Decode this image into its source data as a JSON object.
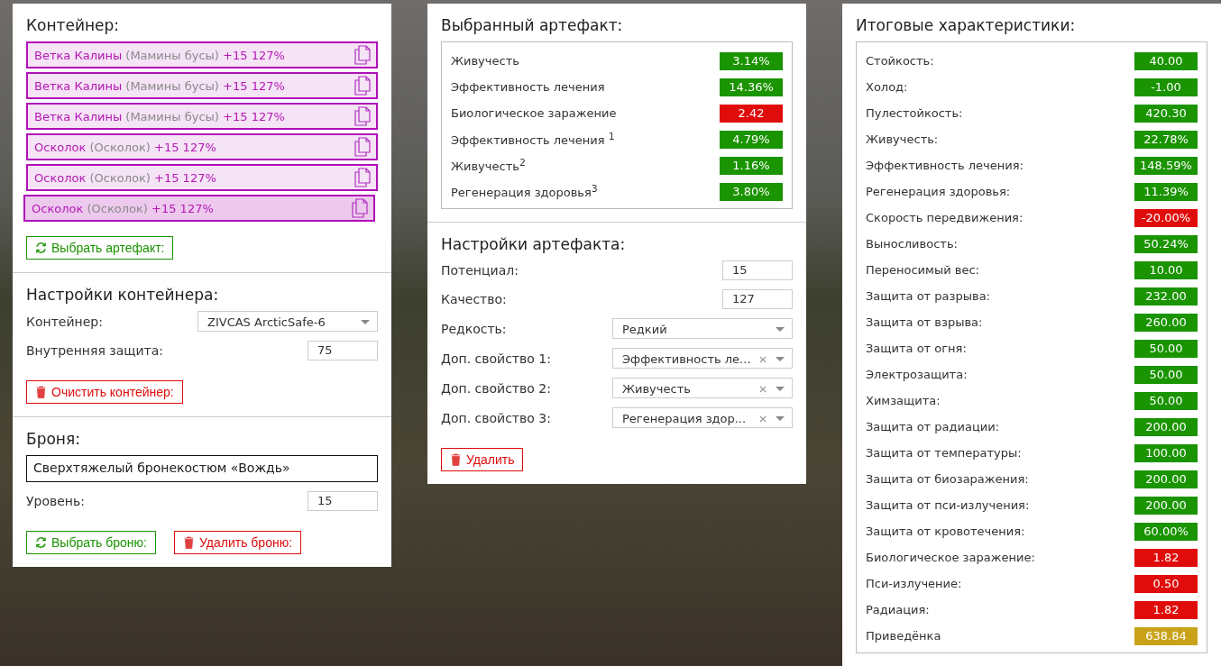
{
  "container_panel": {
    "title": "Контейнер:",
    "slots": [
      {
        "name": "Ветка Калины",
        "original": "(Мамины бусы)",
        "bonus": "+15 127%",
        "selected": false
      },
      {
        "name": "Ветка Калины",
        "original": "(Мамины бусы)",
        "bonus": "+15 127%",
        "selected": false
      },
      {
        "name": "Ветка Калины",
        "original": "(Мамины бусы)",
        "bonus": "+15 127%",
        "selected": false
      },
      {
        "name": "Осколок",
        "original": "(Осколок)",
        "bonus": "+15 127%",
        "selected": false
      },
      {
        "name": "Осколок",
        "original": "(Осколок)",
        "bonus": "+15 127%",
        "selected": false
      },
      {
        "name": "Осколок",
        "original": "(Осколок)",
        "bonus": "+15 127%",
        "selected": true
      }
    ],
    "choose_button": "Выбрать артефакт:"
  },
  "container_settings": {
    "title": "Настройки контейнера:",
    "fields": [
      {
        "kind": "select",
        "label": "Контейнер:",
        "value": "ZIVCAS ArcticSafe-6"
      },
      {
        "kind": "input",
        "label": "Внутренняя защита:",
        "value": "75"
      }
    ],
    "clear_button": "Очистить контейнер:"
  },
  "armor": {
    "title": "Броня:",
    "name": "Сверхтяжелый бронекостюм «Вождь»",
    "level_label": "Уровень:",
    "level_value": "15",
    "choose_button": "Выбрать броню:",
    "delete_button": "Удалить броню:"
  },
  "selected_artifact": {
    "title": "Выбранный артефакт:",
    "stats": [
      {
        "label": "Живучесть",
        "value": "3.14%",
        "color": "#1a9400"
      },
      {
        "label": "Эффективность лечения",
        "value": "14.36%",
        "color": "#1a9400"
      },
      {
        "label": "Биологическое заражение",
        "value": "2.42",
        "color": "#e00b0b"
      },
      {
        "label": "Эффективность лечения $^{1}$",
        "value": "4.79%",
        "color": "#1a9400"
      },
      {
        "label": "Живучесть$^{2}$",
        "value": "1.16%",
        "color": "#1a9400"
      },
      {
        "label": "Регенерация здоровья$^{3}$",
        "value": "3.80%",
        "color": "#1a9400"
      }
    ]
  },
  "artifact_settings": {
    "title": "Настройки артефакта:",
    "fields": [
      {
        "kind": "input",
        "label": "Потенциал:",
        "value": "15"
      },
      {
        "kind": "input",
        "label": "Качество:",
        "value": "127"
      },
      {
        "kind": "select",
        "label": "Редкость:",
        "value": "Редкий"
      },
      {
        "kind": "select_clear",
        "label": "Доп. свойство 1:",
        "value": "Эффективность ле..."
      },
      {
        "kind": "select_clear",
        "label": "Доп. свойство 2:",
        "value": "Живучесть"
      },
      {
        "kind": "select_clear",
        "label": "Доп. свойство 3:",
        "value": "Регенерация здор..."
      }
    ],
    "delete_button": "Удалить"
  },
  "totals": {
    "title": "Итоговые характеристики:",
    "stats": [
      {
        "label": "Стойкость:",
        "value": "40.00",
        "color": "#1a9400"
      },
      {
        "label": "Холод:",
        "value": "-1.00",
        "color": "#1a9400"
      },
      {
        "label": "Пулестойкость:",
        "value": "420.30",
        "color": "#1a9400"
      },
      {
        "label": "Живучесть:",
        "value": "22.78%",
        "color": "#1a9400"
      },
      {
        "label": "Эффективность лечения:",
        "value": "148.59%",
        "color": "#1a9400"
      },
      {
        "label": "Регенерация здоровья:",
        "value": "11.39%",
        "color": "#1a9400"
      },
      {
        "label": "Скорость передвижения:",
        "value": "-20.00%",
        "color": "#e00b0b"
      },
      {
        "label": "Выносливость:",
        "value": "50.24%",
        "color": "#1a9400"
      },
      {
        "label": "Переносимый вес:",
        "value": "10.00",
        "color": "#1a9400"
      },
      {
        "label": "Защита от разрыва:",
        "value": "232.00",
        "color": "#1a9400"
      },
      {
        "label": "Защита от взрыва:",
        "value": "260.00",
        "color": "#1a9400"
      },
      {
        "label": "Защита от огня:",
        "value": "50.00",
        "color": "#1a9400"
      },
      {
        "label": "Электрозащита:",
        "value": "50.00",
        "color": "#1a9400"
      },
      {
        "label": "Химзащита:",
        "value": "50.00",
        "color": "#1a9400"
      },
      {
        "label": "Защита от радиации:",
        "value": "200.00",
        "color": "#1a9400"
      },
      {
        "label": "Защита от температуры:",
        "value": "100.00",
        "color": "#1a9400"
      },
      {
        "label": "Защита от биозаражения:",
        "value": "200.00",
        "color": "#1a9400"
      },
      {
        "label": "Защита от пси-излучения:",
        "value": "200.00",
        "color": "#1a9400"
      },
      {
        "label": "Защита от кровотечения:",
        "value": "60.00%",
        "color": "#1a9400"
      },
      {
        "label": "Биологическое заражение:",
        "value": "1.82",
        "color": "#e00b0b"
      },
      {
        "label": "Пси-излучение:",
        "value": "0.50",
        "color": "#e00b0b"
      },
      {
        "label": "Радиация:",
        "value": "1.82",
        "color": "#e00b0b"
      },
      {
        "label": "Приведёнка",
        "value": "638.84",
        "color": "#c9a21a"
      }
    ]
  }
}
